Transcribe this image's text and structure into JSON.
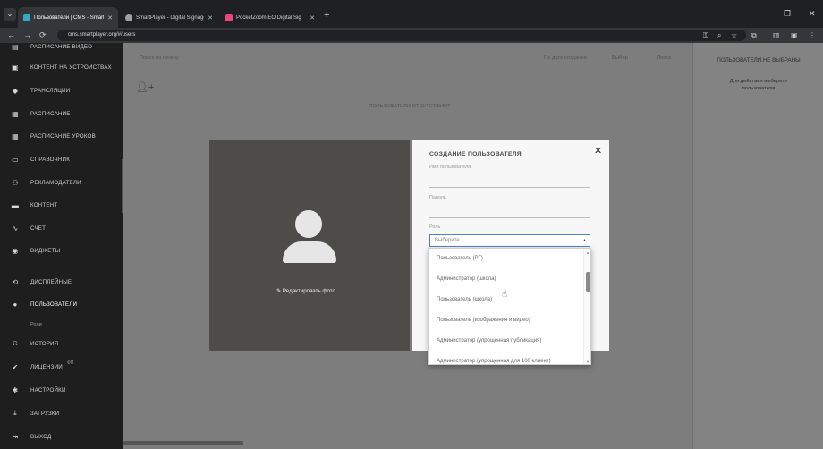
{
  "browser": {
    "tabs": [
      {
        "title": "Пользователи | CMS - SmartP",
        "fav_color": "#34a8c9",
        "active": true
      },
      {
        "title": "SmartPlayer - Digital Signage f",
        "fav_color": "#9aa0a6",
        "active": false
      },
      {
        "title": "PocketZoom ЕО Digital Sig",
        "fav_color": "#e8477a",
        "active": false
      }
    ],
    "url": "cms.smartplayer.org/#/users"
  },
  "sidebar": {
    "items": [
      {
        "label": "РАСПИСАНИЕ ВИДЕО",
        "icon": "▤"
      },
      {
        "label": "КОНТЕНТ НА УСТРОЙСТВАХ",
        "icon": "▣"
      },
      {
        "label": "ТРАНСЛЯЦИИ",
        "icon": "◆"
      },
      {
        "label": "РАСПИСАНИЕ",
        "icon": "▦"
      },
      {
        "label": "РАСПИСАНИЕ УРОКОВ",
        "icon": "▦"
      },
      {
        "label": "СПРАВОЧНИК",
        "icon": "▭"
      },
      {
        "label": "РЕКЛАМОДАТЕЛИ",
        "icon": "⚇"
      },
      {
        "label": "КОНТЕНТ",
        "icon": "▬"
      },
      {
        "label": "СЧЕТ",
        "icon": "∿"
      },
      {
        "label": "ВИДЖЕТЫ",
        "icon": "◉"
      },
      {
        "label": "ДИСПЛЕЙНЫЕ",
        "icon": "⟲"
      },
      {
        "label": "ПОЛЬЗОВАТЕЛИ",
        "icon": "●"
      },
      {
        "label": "ИСТОРИЯ",
        "icon": "⍾"
      },
      {
        "label": "ЛИЦЕНЗИИ",
        "icon": "✔"
      },
      {
        "label": "НАСТРОЙКИ",
        "icon": "✱"
      },
      {
        "label": "ЗАГРУЗКИ",
        "icon": "⤓"
      },
      {
        "label": "ВЫХОД",
        "icon": "⇥"
      }
    ],
    "roles_label": "Роли",
    "license_badge": "ФП"
  },
  "toolbar": {
    "search_placeholder": "Поиск по логину",
    "options": [
      "По дате создания",
      "Выбор",
      "Поиск"
    ]
  },
  "main": {
    "empty_text": "ПОЛЬЗОВАТЕЛИ ОТСУТСТВУЮТ"
  },
  "right_panel": {
    "title": "ПОЛЬЗОВАТЕЛИ НЕ ВЫБРАНЫ",
    "hint": "Для действия выберите пользователя"
  },
  "modal": {
    "edit_photo": "Редактировать фото",
    "title": "СОЗДАНИЕ ПОЛЬЗОВАТЕЛЯ",
    "login_label": "Имя пользователя",
    "password_label": "Пароль",
    "role_label": "Роль",
    "role_placeholder": "Выберите...",
    "role_options": [
      "Пользователь (РГ)",
      "Администратор (школа)",
      "Пользователь (школа)",
      "Пользователь (изображения и видео)",
      "Администратор (упрощенная публикация)",
      "Администратор (упрощенная для 100 клиент)"
    ]
  }
}
